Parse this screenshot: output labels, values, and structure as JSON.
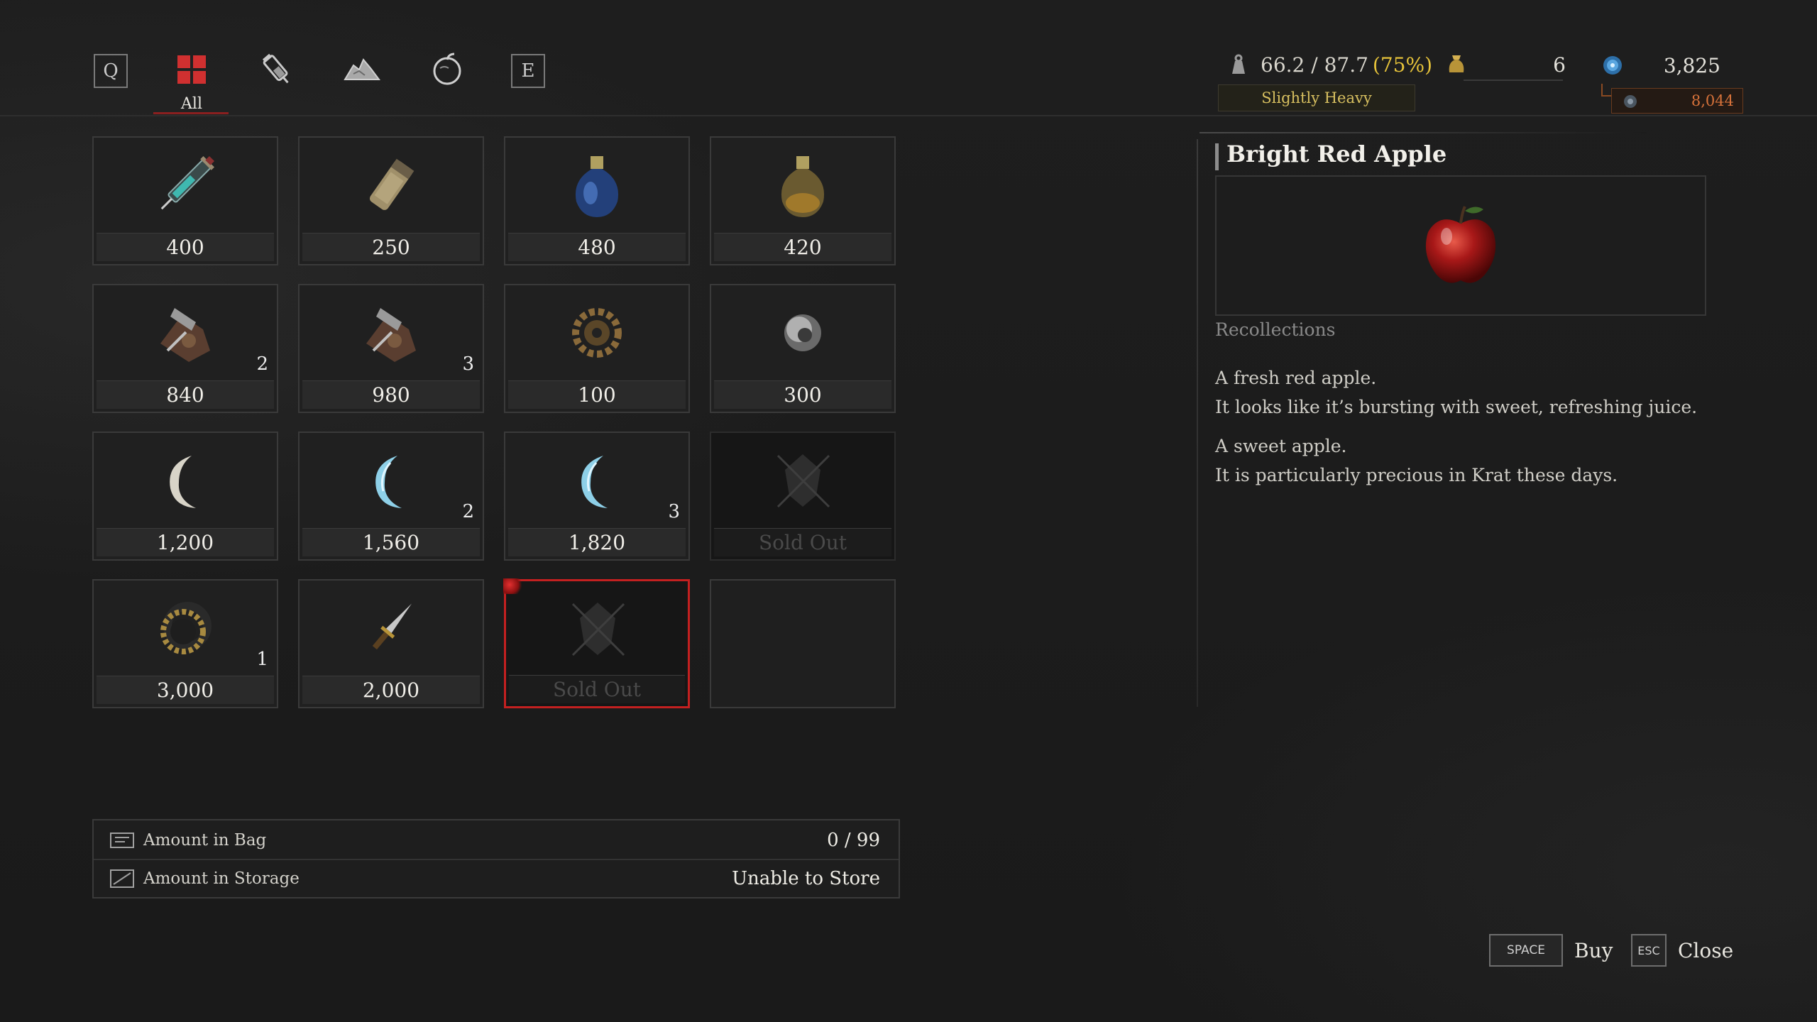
{
  "nav": {
    "left_key": "Q",
    "right_key": "E",
    "active_tab_label": "All",
    "tabs": [
      {
        "icon": "grid-all-icon",
        "label": "All"
      },
      {
        "icon": "consumable-vial-icon"
      },
      {
        "icon": "material-pile-icon"
      },
      {
        "icon": "apple-misc-icon"
      }
    ]
  },
  "stats": {
    "weight": "66.2 / 87.7",
    "weight_percent": "(75%)",
    "weight_status": "Slightly Heavy",
    "gold_coins": "6",
    "ergo": "3,825",
    "ergo_after": "8,044"
  },
  "items": [
    {
      "icon": "syringe-icon",
      "price": "400",
      "qty": ""
    },
    {
      "icon": "cartridge-icon",
      "price": "250",
      "qty": ""
    },
    {
      "icon": "blue-flask-icon",
      "price": "480",
      "qty": ""
    },
    {
      "icon": "amber-flask-icon",
      "price": "420",
      "qty": ""
    },
    {
      "icon": "scrap-parts-icon",
      "price": "840",
      "qty": "2"
    },
    {
      "icon": "scrap-parts-icon",
      "price": "980",
      "qty": "3"
    },
    {
      "icon": "gear-icon",
      "price": "100",
      "qty": ""
    },
    {
      "icon": "moonstone-orb-icon",
      "price": "300",
      "qty": ""
    },
    {
      "icon": "white-crescent-icon",
      "price": "1,200",
      "qty": ""
    },
    {
      "icon": "blue-crescent-icon",
      "price": "1,560",
      "qty": "2"
    },
    {
      "icon": "blue-crescent-icon",
      "price": "1,820",
      "qty": "3"
    },
    {
      "icon": "sold-out-icon",
      "price": "Sold Out",
      "qty": ""
    },
    {
      "icon": "gear-ring-icon",
      "price": "3,000",
      "qty": "1"
    },
    {
      "icon": "dagger-icon",
      "price": "2,000",
      "qty": ""
    },
    {
      "icon": "sold-out-icon",
      "price": "Sold Out",
      "qty": ""
    },
    {
      "icon": "",
      "price": "",
      "qty": ""
    }
  ],
  "info": {
    "bag_label": "Amount in Bag",
    "bag_value": "0 / 99",
    "storage_label": "Amount in Storage",
    "storage_value": "Unable to Store"
  },
  "detail": {
    "title": "Bright Red Apple",
    "icon": "red-apple-icon",
    "category": "Recollections",
    "desc1_line1": "A fresh red apple.",
    "desc1_line2": "It looks like it’s bursting with sweet, refreshing juice.",
    "desc2_line1": "A sweet apple.",
    "desc2_line2": "It is particularly precious in Krat these days."
  },
  "keys": {
    "buy_key": "SPACE",
    "buy_label": "Buy",
    "close_key": "ESC",
    "close_label": "Close"
  },
  "colors": {
    "selection": "#c42020",
    "weight_percent": "#e6c33a",
    "ergo_after": "#d7723a",
    "weight_status": "#d8c060"
  }
}
